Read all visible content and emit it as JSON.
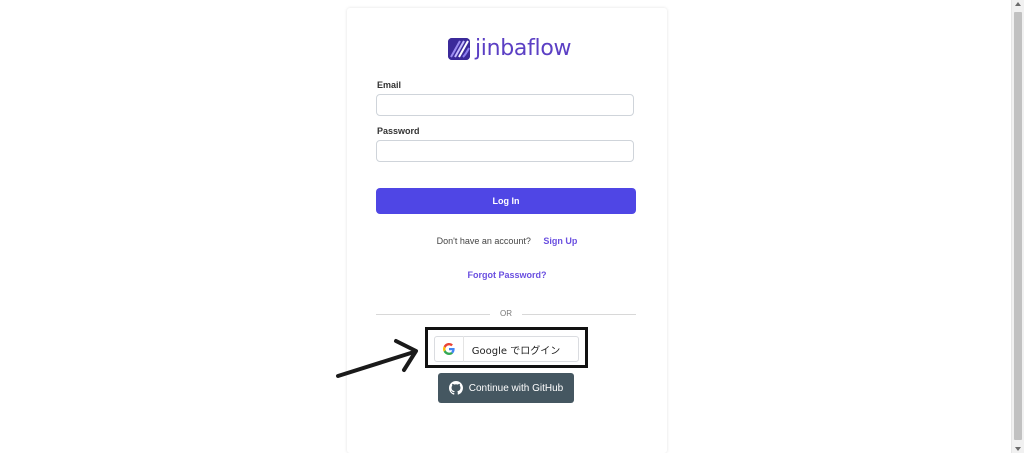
{
  "brand": {
    "name": "jinbaflow",
    "color": "#5b3fc4",
    "logo_icon": "jinbaflow-logo-icon"
  },
  "form": {
    "email_label": "Email",
    "email_value": "",
    "password_label": "Password",
    "password_value": "",
    "login_label": "Log In",
    "login_color": "#4f46e5"
  },
  "signup": {
    "prompt": "Don't have an account?",
    "link": "Sign Up"
  },
  "forgot_label": "Forgot Password?",
  "divider_label": "OR",
  "google": {
    "icon": "google-g-icon",
    "label": "Google でログイン"
  },
  "github": {
    "icon": "github-icon",
    "label": "Continue with GitHub",
    "color": "#455761"
  },
  "annotation": {
    "arrow": "arrow-pointing-right",
    "highlight": "highlight-box"
  }
}
